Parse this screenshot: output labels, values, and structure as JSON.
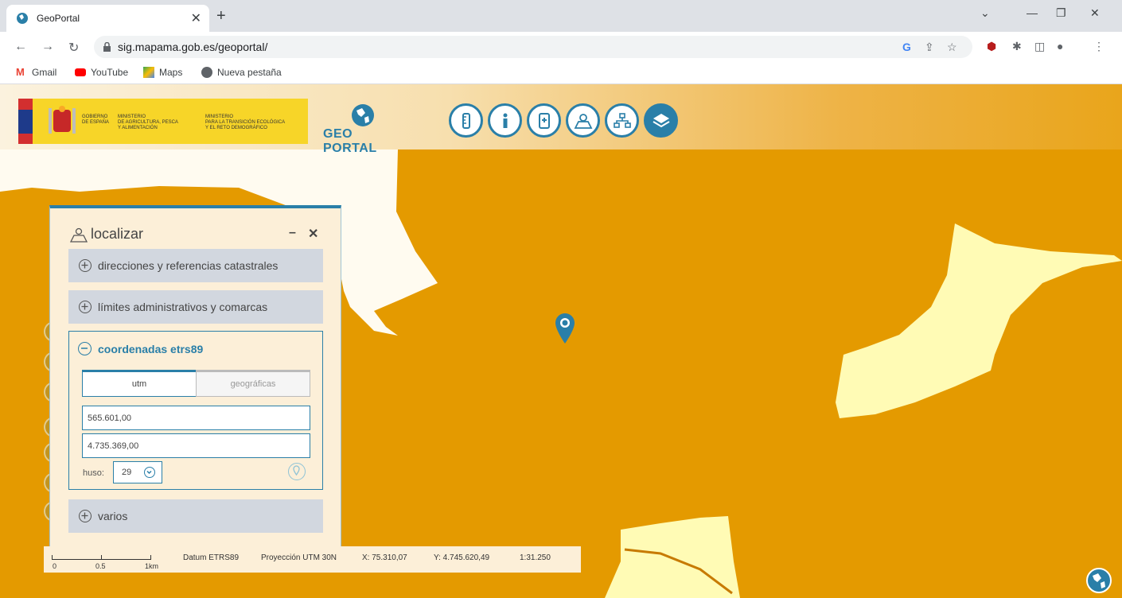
{
  "browser": {
    "tab_title": "GeoPortal",
    "url": "sig.mapama.gob.es/geoportal/",
    "bookmarks": [
      {
        "label": "Gmail",
        "icon": "gmail-icon"
      },
      {
        "label": "YouTube",
        "icon": "youtube-icon"
      },
      {
        "label": "Maps",
        "icon": "maps-icon"
      },
      {
        "label": "Nueva pestaña",
        "icon": "globe-icon"
      }
    ]
  },
  "header": {
    "gov_text_1": "GOBIERNO\nDE ESPAÑA",
    "gov_text_2": "MINISTERIO\nDE AGRICULTURA, PESCA\nY ALIMENTACIÓN",
    "gov_text_3": "MINISTERIO\nPARA LA TRANSICIÓN ECOLÓGICA\nY EL RETO DEMOGRÁFICO",
    "logo_text": "GEO PORTAL",
    "tools": [
      "ruler-icon",
      "info-icon",
      "bookmark-icon",
      "locate-icon",
      "hierarchy-icon",
      "layers-icon"
    ]
  },
  "panel": {
    "title": "localizar",
    "sections": [
      {
        "label": "direcciones y referencias catastrales"
      },
      {
        "label": "límites administrativos y comarcas"
      },
      {
        "label": "coordenadas etrs89"
      },
      {
        "label": "varios"
      }
    ],
    "tabs": [
      "utm",
      "geográficas"
    ],
    "x_value": "565.601,00",
    "y_value": "4.735.369,00",
    "huso_label": "huso:",
    "huso_value": "29"
  },
  "status": {
    "scale_labels": [
      "0",
      "0.5",
      "1km"
    ],
    "datum": "Datum ETRS89",
    "projection": "Proyección UTM 30N",
    "x": "X: 75.310,07",
    "y": "Y: 4.745.620,49",
    "scale": "1:31.250"
  },
  "colors": {
    "accent": "#2a7fa8",
    "map_orange": "#e49a00",
    "map_pale": "#fffbb5",
    "panel_bg": "#fcefd8"
  }
}
